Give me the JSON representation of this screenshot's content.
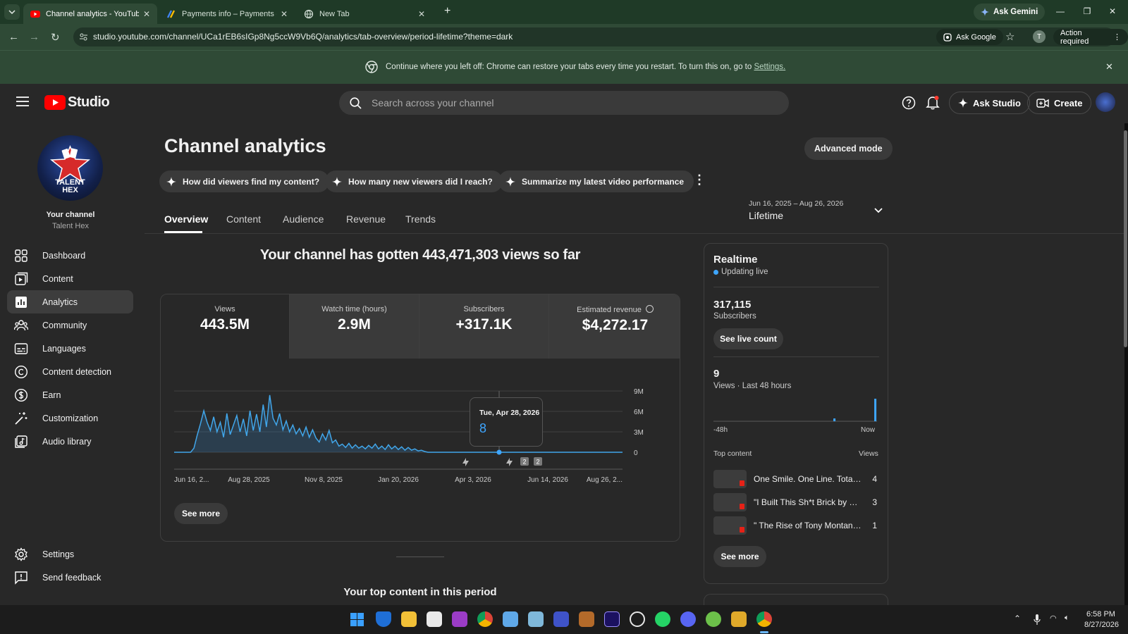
{
  "browser": {
    "tabs": [
      {
        "title": "Channel analytics - YouTube Studio",
        "active": true
      },
      {
        "title": "Payments info – Payments – Google",
        "active": false
      },
      {
        "title": "New Tab",
        "active": false
      }
    ],
    "ask_gemini": "Ask Gemini",
    "url": "studio.youtube.com/channel/UCa1rEB6sIGp8Ng5ccW9Vb6Q/analytics/tab-overview/period-lifetime?theme=dark",
    "ask_google": "Ask Google",
    "profile_initial": "T",
    "action_required": "Action required"
  },
  "banner": {
    "text": "Continue where you left off: Chrome can restore your tabs every time you restart. To turn this on, go to",
    "link": "Settings."
  },
  "header": {
    "logo_text": "Studio",
    "search_placeholder": "Search across your channel",
    "ask_studio": "Ask Studio",
    "create": "Create"
  },
  "sidebar": {
    "channel_label": "Your channel",
    "channel_name": "Talent Hex",
    "avatar_text": "TALENT HEX",
    "items": [
      {
        "label": "Dashboard",
        "icon": "dashboard-icon"
      },
      {
        "label": "Content",
        "icon": "content-icon"
      },
      {
        "label": "Analytics",
        "icon": "analytics-icon",
        "active": true
      },
      {
        "label": "Community",
        "icon": "community-icon"
      },
      {
        "label": "Languages",
        "icon": "languages-icon"
      },
      {
        "label": "Content detection",
        "icon": "copyright-icon"
      },
      {
        "label": "Earn",
        "icon": "earn-icon"
      },
      {
        "label": "Customization",
        "icon": "customization-icon"
      },
      {
        "label": "Audio library",
        "icon": "audio-library-icon"
      }
    ],
    "settings": "Settings",
    "feedback": "Send feedback"
  },
  "main": {
    "title": "Channel analytics",
    "advanced_mode": "Advanced mode",
    "chips": [
      "How did viewers find my content?",
      "How many new viewers did I reach?",
      "Summarize my latest video performance"
    ],
    "tabs": [
      "Overview",
      "Content",
      "Audience",
      "Revenue",
      "Trends"
    ],
    "period_range": "Jun 16, 2025 – Aug 26, 2026",
    "period_label": "Lifetime",
    "headline": "Your channel has gotten 443,471,303 views so far",
    "metrics": [
      {
        "label": "Views",
        "value": "443.5M"
      },
      {
        "label": "Watch time (hours)",
        "value": "2.9M"
      },
      {
        "label": "Subscribers",
        "value": "+317.1K"
      },
      {
        "label": "Estimated revenue",
        "value": "$4,272.17"
      }
    ],
    "tooltip": {
      "date": "Tue, Apr 28, 2026",
      "value": "8"
    },
    "markers": [
      "2",
      "2"
    ],
    "see_more": "See more",
    "top_content_heading": "Your top content in this period"
  },
  "chart_data": {
    "type": "line",
    "x_labels": [
      "Jun 16, 2...",
      "Aug 28, 2025",
      "Nov 8, 2025",
      "Jan 20, 2026",
      "Apr 3, 2026",
      "Jun 14, 2026",
      "Aug 26, 2..."
    ],
    "y_ticks": [
      "9M",
      "6M",
      "3M",
      "0"
    ],
    "ylim": [
      0,
      9000000
    ],
    "series": [
      {
        "values": [
          0,
          0,
          0,
          0,
          0,
          0,
          600000,
          2500000,
          4200000,
          6100000,
          4400000,
          3200000,
          5200000,
          3000000,
          4400000,
          2200000,
          5700000,
          2600000,
          4000000,
          5400000,
          3000000,
          4900000,
          2400000,
          6100000,
          3200000,
          5600000,
          3000000,
          7000000,
          3700000,
          8400000,
          5000000,
          4000000,
          5700000,
          3300000,
          4600000,
          3000000,
          4000000,
          2700000,
          3500000,
          2400000,
          3700000,
          2200000,
          3300000,
          2100000,
          1500000,
          2700000,
          1800000,
          3200000,
          1400000,
          1800000,
          900000,
          1200000,
          700000,
          1300000,
          600000,
          1100000,
          600000,
          900000,
          500000,
          1000000,
          600000,
          1200000,
          500000,
          900000,
          400000,
          1100000,
          500000,
          900000,
          400000,
          800000,
          300000,
          700000,
          300000,
          500000,
          200000,
          300000,
          100000,
          0,
          0,
          0,
          0,
          0,
          0,
          0,
          0,
          0,
          0,
          0,
          0,
          0,
          0,
          0,
          0,
          0,
          0,
          0,
          0,
          0,
          0,
          0,
          0,
          0,
          0,
          0,
          0,
          0,
          0,
          0,
          0,
          0,
          0,
          0,
          0,
          0,
          0,
          0,
          0,
          0,
          0,
          0,
          0,
          0,
          0,
          0,
          0,
          0,
          0,
          0,
          0,
          0,
          0,
          0,
          0,
          0,
          0,
          0,
          0
        ]
      }
    ],
    "grid": true
  },
  "realtime": {
    "title": "Realtime",
    "status": "Updating live",
    "subscribers": "317,115",
    "subscribers_label": "Subscribers",
    "see_live_count": "See live count",
    "views": "9",
    "views_label": "Views · Last 48 hours",
    "axis_start": "-48h",
    "axis_end": "Now",
    "bars": [
      0,
      0,
      0,
      0,
      0,
      0,
      0,
      0,
      0,
      0,
      0,
      0,
      0,
      0,
      0,
      0,
      0,
      0,
      0,
      0,
      0,
      0,
      0,
      0,
      0,
      0,
      0,
      0,
      0,
      0,
      0,
      0,
      0,
      0,
      0,
      1,
      0,
      0,
      0,
      0,
      0,
      0,
      0,
      0,
      0,
      0,
      0,
      8
    ],
    "top_content_label": "Top content",
    "views_col": "Views",
    "top_content": [
      {
        "title": "One Smile. One Line. Total ...",
        "views": "4"
      },
      {
        "title": "\"I Built This Sh*t Brick by Br...",
        "views": "3"
      },
      {
        "title": "\" The Rise of Tony Montana...",
        "views": "1"
      }
    ],
    "see_more": "See more"
  },
  "taskbar": {
    "time": "6:58 PM",
    "date": "8/27/2026"
  },
  "colors": {
    "accent": "#3ea6ff",
    "youtube_red": "#ff0000",
    "chrome_green": "#2f4a36"
  }
}
